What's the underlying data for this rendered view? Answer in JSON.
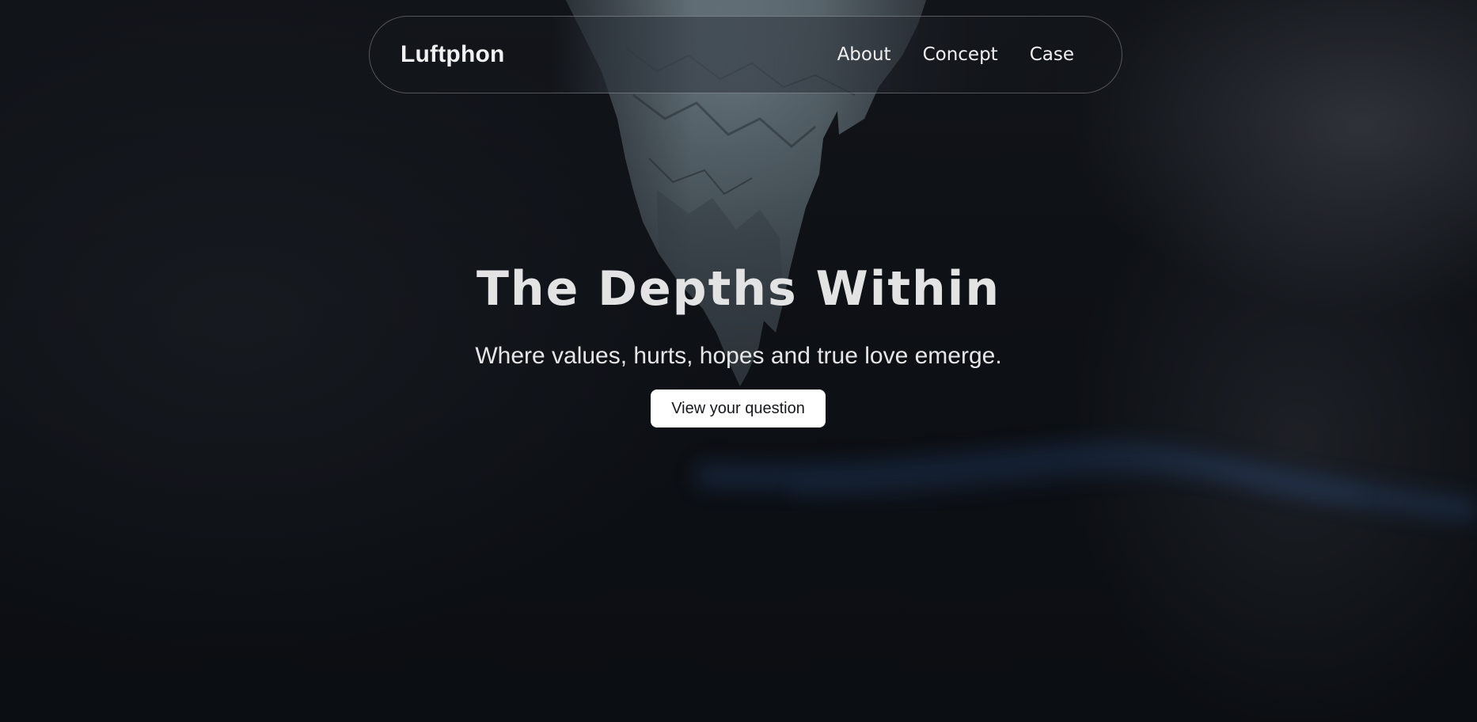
{
  "header": {
    "brand": "Luftphon",
    "nav": [
      {
        "label": "About"
      },
      {
        "label": "Concept"
      },
      {
        "label": "Case"
      }
    ]
  },
  "hero": {
    "title": "The Depths Within",
    "subtitle": "Where values, hurts, hopes and true love emerge.",
    "cta_label": "View your question"
  },
  "colors": {
    "background": "#0c0f14",
    "rock": "#5f6e76",
    "text": "#e3e3e3",
    "button_bg": "#ffffff",
    "accent_glow": "#2a4a78"
  }
}
